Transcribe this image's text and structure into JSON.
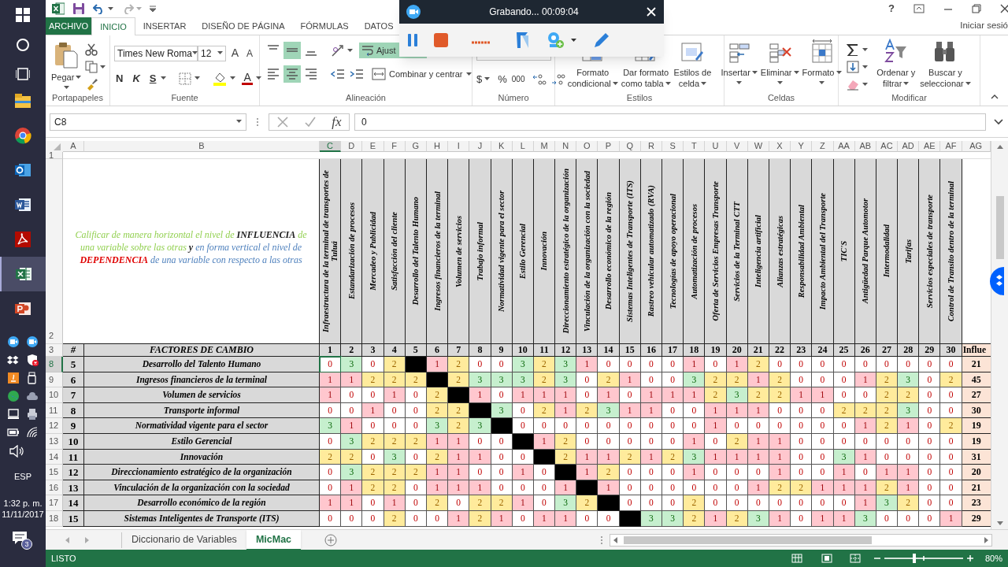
{
  "taskbar": {
    "language": "ESP",
    "time": "1:32 p. m.",
    "date": "11/11/2017",
    "notification_count": "3"
  },
  "window": {
    "help": "?",
    "account": "Iniciar sesió"
  },
  "recorder": {
    "status": "Grabando... 00:09:04"
  },
  "ribbon_tabs": [
    {
      "label": "ARCHIVO",
      "kind": "file",
      "selected": false
    },
    {
      "label": "INICIO",
      "kind": "tab",
      "selected": true
    },
    {
      "label": "INSERTAR",
      "kind": "tab",
      "selected": false
    },
    {
      "label": "DISEÑO DE PÁGINA",
      "kind": "tab",
      "selected": false
    },
    {
      "label": "FÓRMULAS",
      "kind": "tab",
      "selected": false
    },
    {
      "label": "DATOS",
      "kind": "tab",
      "selected": false
    }
  ],
  "ribbon": {
    "clipboard": {
      "label": "Portapapeles",
      "paste": "Pegar"
    },
    "font": {
      "label": "Fuente",
      "name": "Times New Roma",
      "size": "12",
      "grow": "A",
      "shrink": "A",
      "bold": "N",
      "italic": "K",
      "underline": "S",
      "font_color_label": "A"
    },
    "alignment": {
      "label": "Alineación",
      "vertical": [
        {
          "selected": false
        },
        {
          "selected": true
        },
        {
          "selected": false
        }
      ],
      "horizontal": [
        {
          "selected": false
        },
        {
          "selected": true
        },
        {
          "selected": false
        }
      ],
      "wrap_text": {
        "label": "Ajust",
        "on": true
      },
      "merge": "Combinar y centrar"
    },
    "number": {
      "label": "Número",
      "currency": "$",
      "percent": "%",
      "thousands": "000"
    },
    "styles": {
      "label": "Estilos",
      "buttons": [
        {
          "kind": "conditional",
          "lines": [
            "Formato",
            "condicional"
          ]
        },
        {
          "kind": "table",
          "lines": [
            "Dar formato",
            "como tabla"
          ]
        },
        {
          "kind": "cellstyle",
          "lines": [
            "Estilos de",
            "celda"
          ]
        }
      ]
    },
    "cells": {
      "label": "Celdas",
      "buttons": [
        {
          "kind": "insert",
          "lines": [
            "Insertar"
          ]
        },
        {
          "kind": "delete",
          "lines": [
            "Eliminar"
          ]
        },
        {
          "kind": "format",
          "lines": [
            "Formato"
          ]
        }
      ]
    },
    "editing": {
      "label": "Modificar",
      "buttons": [
        {
          "kind": "sort",
          "lines": [
            "Ordenar y",
            "filtrar"
          ]
        },
        {
          "kind": "find",
          "lines": [
            "Buscar y",
            "seleccionar"
          ]
        }
      ]
    }
  },
  "formula_bar": {
    "name_box": "C8",
    "function_label": "fx",
    "value": "0"
  },
  "sheet": {
    "column_letters": [
      {
        "label": "A",
        "selected": false
      },
      {
        "label": "B",
        "selected": false
      },
      {
        "label": "C",
        "selected": true
      },
      {
        "label": "D",
        "selected": false
      },
      {
        "label": "E",
        "selected": false
      },
      {
        "label": "F",
        "selected": false
      },
      {
        "label": "G",
        "selected": false
      },
      {
        "label": "H",
        "selected": false
      },
      {
        "label": "I",
        "selected": false
      },
      {
        "label": "J",
        "selected": false
      },
      {
        "label": "K",
        "selected": false
      },
      {
        "label": "L",
        "selected": false
      },
      {
        "label": "M",
        "selected": false
      },
      {
        "label": "N",
        "selected": false
      },
      {
        "label": "O",
        "selected": false
      },
      {
        "label": "P",
        "selected": false
      },
      {
        "label": "Q",
        "selected": false
      },
      {
        "label": "R",
        "selected": false
      },
      {
        "label": "S",
        "selected": false
      },
      {
        "label": "T",
        "selected": false
      },
      {
        "label": "U",
        "selected": false
      },
      {
        "label": "V",
        "selected": false
      },
      {
        "label": "W",
        "selected": false
      },
      {
        "label": "X",
        "selected": false
      },
      {
        "label": "Y",
        "selected": false
      },
      {
        "label": "Z",
        "selected": false
      },
      {
        "label": "AA",
        "selected": false
      },
      {
        "label": "AB",
        "selected": false
      },
      {
        "label": "AC",
        "selected": false
      },
      {
        "label": "AD",
        "selected": false
      },
      {
        "label": "AE",
        "selected": false
      },
      {
        "label": "AF",
        "selected": false
      },
      {
        "label": "AG",
        "selected": false
      }
    ],
    "top_row_numbers": [
      "1",
      "2",
      "3"
    ],
    "instruction": [
      {
        "text": "Calificar de manera horizontal el nivel de",
        "color": "#92d050"
      },
      {
        "text": "**INFLUENCIA**",
        "color": "#1a1a1a"
      },
      {
        "text": "de una variable sobre las otras",
        "color": "#92d050"
      },
      {
        "text": "**y**",
        "color": "#1a1a1a"
      },
      {
        "text": "en forma vertical el nivel de",
        "color": "#4f81bd"
      },
      {
        "text": "**DEPENDENCIA**",
        "color": "#e00000"
      },
      {
        "text": "de una variable con respecto a las otras",
        "color": "#4f81bd"
      }
    ],
    "header": {
      "number": "#",
      "factors": "FACTORES DE CAMBIO",
      "total": "Influe"
    },
    "variables": [
      {
        "number": "1",
        "name": "Infraestructura de la terminal de transportes de Tuluá"
      },
      {
        "number": "2",
        "name": "Estandarización de procesos"
      },
      {
        "number": "3",
        "name": "Mercadeo y Publicidad"
      },
      {
        "number": "4",
        "name": "Satisfacción del cliente"
      },
      {
        "number": "5",
        "name": "Desarrollo del Talento Humano"
      },
      {
        "number": "6",
        "name": "Ingresos financieros de la terminal"
      },
      {
        "number": "7",
        "name": "Volumen de servicios"
      },
      {
        "number": "8",
        "name": "Trabajo informal"
      },
      {
        "number": "9",
        "name": "Normatividad vigente para el sector"
      },
      {
        "number": "10",
        "name": "Estilo Gerencial"
      },
      {
        "number": "11",
        "name": "Innovación"
      },
      {
        "number": "12",
        "name": "Direccionamiento estratégico de la organización"
      },
      {
        "number": "13",
        "name": "Vinculación de la organización con la sociedad"
      },
      {
        "number": "14",
        "name": "Desarrollo económico de la región"
      },
      {
        "number": "15",
        "name": "Sistemas Inteligentes de Transporte (ITS)"
      },
      {
        "number": "16",
        "name": "Rastreo vehicular automatizado (RVA)"
      },
      {
        "number": "17",
        "name": "Tecnologías de apoyo operacional"
      },
      {
        "number": "18",
        "name": "Automatización de procesos"
      },
      {
        "number": "19",
        "name": "Oferta de Servicios Empresas Transporte"
      },
      {
        "number": "20",
        "name": "Servicios de la Terminal CTT"
      },
      {
        "number": "21",
        "name": "Inteligencia artificial"
      },
      {
        "number": "22",
        "name": "Alianzas estratégicas"
      },
      {
        "number": "23",
        "name": "Responsabilidad Ambiental"
      },
      {
        "number": "24",
        "name": "Impacto Ambiental del Transporte"
      },
      {
        "number": "25",
        "name": "TIC'S"
      },
      {
        "number": "26",
        "name": "Antigüedad Parque Automotor"
      },
      {
        "number": "27",
        "name": "Intermodalidad"
      },
      {
        "number": "28",
        "name": "Tarifas"
      },
      {
        "number": "29",
        "name": "Servicios especiales de transporte"
      },
      {
        "number": "30",
        "name": "Control de Transito dentro de la terminal"
      }
    ],
    "rows": [
      {
        "row_number": "8",
        "selected": true,
        "number": "5",
        "name": "Desarrollo del Talento Humano",
        "values_before": [
          "0",
          "3",
          "0",
          "2"
        ],
        "values_after": [
          "1",
          "2",
          "0",
          "0",
          "3",
          "2",
          "3",
          "1",
          "0",
          "0",
          "0",
          "0",
          "1",
          "0",
          "1",
          "2",
          "0",
          "0",
          "0",
          "0",
          "0",
          "0",
          "0",
          "0",
          "0"
        ],
        "total": "21"
      },
      {
        "row_number": "9",
        "selected": false,
        "number": "6",
        "name": "Ingresos financieros de la terminal",
        "values_before": [
          "1",
          "1",
          "2",
          "2",
          "2"
        ],
        "values_after": [
          "2",
          "3",
          "3",
          "3",
          "2",
          "3",
          "0",
          "2",
          "1",
          "0",
          "0",
          "3",
          "2",
          "2",
          "1",
          "2",
          "0",
          "0",
          "0",
          "1",
          "2",
          "3",
          "0",
          "2"
        ],
        "total": "45"
      },
      {
        "row_number": "10",
        "selected": false,
        "number": "7",
        "name": "Volumen de servicios",
        "values_before": [
          "1",
          "0",
          "0",
          "1",
          "0",
          "2"
        ],
        "values_after": [
          "1",
          "0",
          "1",
          "1",
          "1",
          "0",
          "1",
          "0",
          "1",
          "1",
          "1",
          "2",
          "3",
          "2",
          "2",
          "1",
          "1",
          "0",
          "0",
          "2",
          "2",
          "0",
          "0"
        ],
        "total": "27"
      },
      {
        "row_number": "11",
        "selected": false,
        "number": "8",
        "name": "Transporte informal",
        "values_before": [
          "0",
          "0",
          "1",
          "0",
          "0",
          "2",
          "2"
        ],
        "values_after": [
          "3",
          "0",
          "2",
          "1",
          "2",
          "3",
          "1",
          "1",
          "0",
          "0",
          "1",
          "1",
          "1",
          "0",
          "0",
          "0",
          "2",
          "2",
          "2",
          "3",
          "0",
          "0"
        ],
        "total": "30"
      },
      {
        "row_number": "12",
        "selected": false,
        "number": "9",
        "name": "Normatividad vigente para el sector",
        "values_before": [
          "3",
          "1",
          "0",
          "0",
          "0",
          "3",
          "2",
          "3"
        ],
        "values_after": [
          "0",
          "0",
          "0",
          "0",
          "0",
          "0",
          "0",
          "0",
          "0",
          "1",
          "0",
          "0",
          "0",
          "0",
          "0",
          "0",
          "1",
          "2",
          "1",
          "0",
          "2"
        ],
        "total": "19"
      },
      {
        "row_number": "13",
        "selected": false,
        "number": "10",
        "name": "Estilo Gerencial",
        "values_before": [
          "0",
          "3",
          "2",
          "2",
          "2",
          "1",
          "1",
          "0",
          "0"
        ],
        "values_after": [
          "1",
          "2",
          "0",
          "0",
          "0",
          "0",
          "0",
          "1",
          "0",
          "2",
          "1",
          "1",
          "0",
          "0",
          "0",
          "0",
          "0",
          "0",
          "0",
          "0"
        ],
        "total": "19"
      },
      {
        "row_number": "14",
        "selected": false,
        "number": "11",
        "name": "Innovación",
        "values_before": [
          "2",
          "2",
          "0",
          "3",
          "0",
          "2",
          "1",
          "1",
          "0",
          "0"
        ],
        "values_after": [
          "2",
          "1",
          "1",
          "2",
          "1",
          "2",
          "3",
          "1",
          "1",
          "1",
          "1",
          "0",
          "0",
          "3",
          "1",
          "0",
          "0",
          "0",
          "0"
        ],
        "total": "31"
      },
      {
        "row_number": "15",
        "selected": false,
        "number": "12",
        "name": "Direccionamiento estratégico de la organización",
        "values_before": [
          "0",
          "3",
          "2",
          "2",
          "2",
          "1",
          "1",
          "0",
          "0",
          "1",
          "0"
        ],
        "values_after": [
          "1",
          "2",
          "0",
          "0",
          "0",
          "1",
          "0",
          "0",
          "0",
          "1",
          "0",
          "0",
          "1",
          "0",
          "1",
          "1",
          "0",
          "0"
        ],
        "total": "20"
      },
      {
        "row_number": "16",
        "selected": false,
        "number": "13",
        "name": "Vinculación de la organización con la sociedad",
        "values_before": [
          "0",
          "1",
          "2",
          "2",
          "0",
          "1",
          "1",
          "1",
          "0",
          "0",
          "0",
          "1"
        ],
        "values_after": [
          "1",
          "0",
          "0",
          "0",
          "0",
          "0",
          "0",
          "1",
          "2",
          "2",
          "1",
          "1",
          "1",
          "2",
          "1",
          "0",
          "0"
        ],
        "total": "21"
      },
      {
        "row_number": "17",
        "selected": false,
        "number": "14",
        "name": "Desarrollo económico de la región",
        "values_before": [
          "1",
          "1",
          "0",
          "1",
          "0",
          "2",
          "0",
          "2",
          "2",
          "1",
          "0",
          "3",
          "2"
        ],
        "values_after": [
          "0",
          "0",
          "0",
          "2",
          "0",
          "0",
          "0",
          "0",
          "0",
          "0",
          "0",
          "1",
          "3",
          "2",
          "0",
          "0"
        ],
        "total": "23"
      },
      {
        "row_number": "18",
        "selected": false,
        "number": "15",
        "name": "Sistemas Inteligentes de Transporte (ITS)",
        "values_before": [
          "0",
          "0",
          "0",
          "2",
          "0",
          "0",
          "1",
          "2",
          "1",
          "0",
          "1",
          "1",
          "0",
          "0"
        ],
        "values_after": [
          "3",
          "3",
          "2",
          "1",
          "2",
          "3",
          "1",
          "0",
          "1",
          "1",
          "3",
          "0",
          "0",
          "0",
          "1"
        ],
        "total": "29"
      }
    ]
  },
  "sheet_tabs": [
    {
      "label": "Diccionario de Variables",
      "selected": false
    },
    {
      "label": "MicMac",
      "selected": true
    }
  ],
  "status_bar": {
    "mode": "LISTO",
    "zoom": "80%",
    "zoom_slider": {
      "level": 0.38
    }
  }
}
